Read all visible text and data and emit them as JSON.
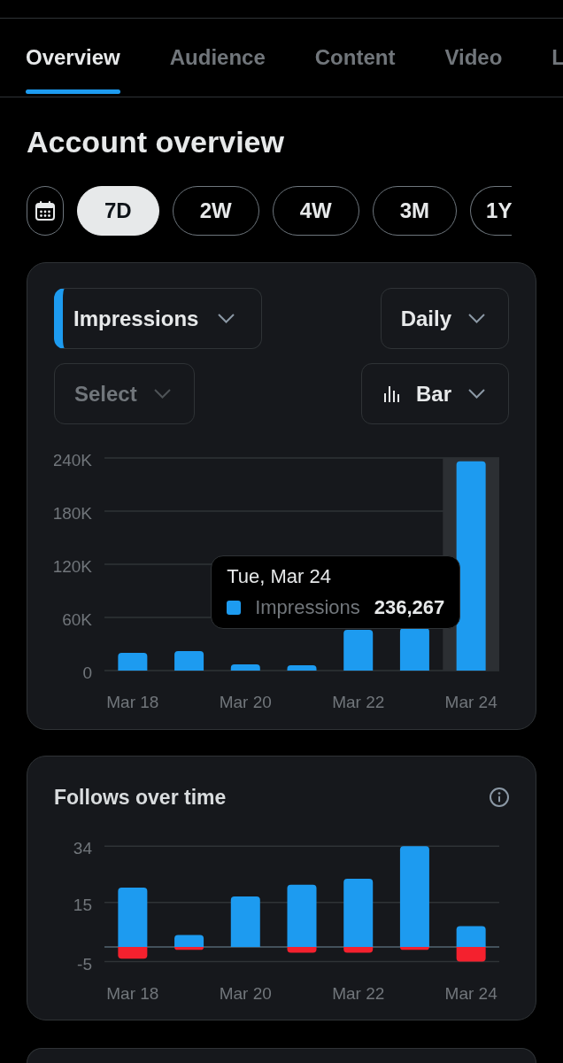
{
  "tabs": [
    {
      "label": "Overview",
      "selected": true
    },
    {
      "label": "Audience",
      "selected": false
    },
    {
      "label": "Content",
      "selected": false
    },
    {
      "label": "Video",
      "selected": false
    },
    {
      "label": "L",
      "selected": false
    }
  ],
  "heading": "Account overview",
  "date_ranges": [
    {
      "label": "7D",
      "selected": true
    },
    {
      "label": "2W",
      "selected": false
    },
    {
      "label": "4W",
      "selected": false
    },
    {
      "label": "3M",
      "selected": false
    },
    {
      "label": "1Y",
      "selected": false
    }
  ],
  "impressions_card": {
    "metric_select": {
      "value": "Impressions"
    },
    "interval_select": {
      "value": "Daily"
    },
    "compare_select": {
      "placeholder": "Select"
    },
    "chart_type_select": {
      "value": "Bar"
    },
    "chart_data": {
      "type": "bar",
      "categories": [
        "Mar 18",
        null,
        "Mar 20",
        null,
        "Mar 22",
        null,
        "Mar 24"
      ],
      "series": [
        {
          "name": "Impressions",
          "color": "#1d9bf0",
          "values": [
            20000,
            22000,
            7000,
            6000,
            46000,
            48000,
            236267
          ]
        }
      ],
      "ylim": [
        0,
        240000
      ],
      "yticks": [
        {
          "value": 0,
          "label": "0"
        },
        {
          "value": 60000,
          "label": "60K"
        },
        {
          "value": 120000,
          "label": "120K"
        },
        {
          "value": 180000,
          "label": "180K"
        },
        {
          "value": 240000,
          "label": "240K"
        }
      ],
      "grid": true,
      "bands": [
        {
          "axis": "x",
          "from": "Mar 24",
          "to": "Mar 24",
          "color": "#2c2f33"
        }
      ]
    },
    "tooltip": {
      "title": "Tue, Mar 24",
      "value": "236,267"
    }
  },
  "follows_card": {
    "title": "Follows over time",
    "chart_data": {
      "type": "bar",
      "stacked": true,
      "categories": [
        "Mar 18",
        null,
        "Mar 20",
        null,
        "Mar 22",
        null,
        "Mar 24"
      ],
      "series": [
        {
          "color": "#1d9bf0",
          "values": [
            20,
            4,
            17,
            21,
            23,
            34,
            7
          ]
        },
        {
          "color": "#f4212e",
          "values": [
            -4,
            -1,
            0,
            -2,
            -2,
            -1,
            -5
          ]
        }
      ],
      "ylim": [
        -5,
        34
      ],
      "yticks": [
        -5,
        15,
        34
      ],
      "grid": true
    }
  }
}
